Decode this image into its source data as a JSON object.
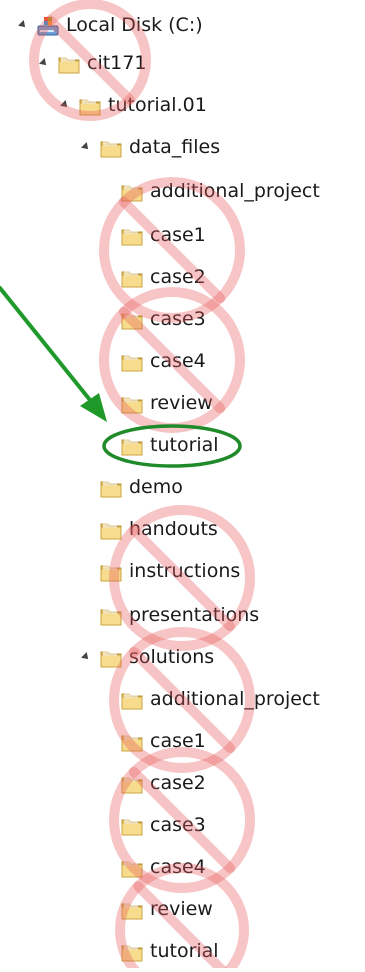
{
  "tree": {
    "items": [
      {
        "label": "Local Disk (C:)",
        "level": 0,
        "expanded": true,
        "icon": "drive-icon"
      },
      {
        "label": "cit171",
        "level": 1,
        "expanded": true,
        "icon": "folder-icon"
      },
      {
        "label": "tutorial.01",
        "level": 2,
        "expanded": true,
        "icon": "folder-icon"
      },
      {
        "label": "data_files",
        "level": 3,
        "expanded": true,
        "icon": "folder-icon"
      },
      {
        "label": "additional_project",
        "level": 4,
        "icon": "folder-icon"
      },
      {
        "label": "case1",
        "level": 4,
        "icon": "folder-icon"
      },
      {
        "label": "case2",
        "level": 4,
        "icon": "folder-icon"
      },
      {
        "label": "case3",
        "level": 4,
        "icon": "folder-icon"
      },
      {
        "label": "case4",
        "level": 4,
        "icon": "folder-icon"
      },
      {
        "label": "review",
        "level": 4,
        "icon": "folder-icon"
      },
      {
        "label": "tutorial",
        "level": 4,
        "icon": "folder-icon",
        "highlighted": true
      },
      {
        "label": "demo",
        "level": 3,
        "icon": "folder-icon"
      },
      {
        "label": "handouts",
        "level": 3,
        "icon": "folder-icon"
      },
      {
        "label": "instructions",
        "level": 3,
        "icon": "folder-icon"
      },
      {
        "label": "presentations",
        "level": 3,
        "icon": "folder-icon"
      },
      {
        "label": "solutions",
        "level": 3,
        "expanded": true,
        "icon": "folder-icon"
      },
      {
        "label": "additional_project",
        "level": 4,
        "icon": "folder-icon"
      },
      {
        "label": "case1",
        "level": 4,
        "icon": "folder-icon"
      },
      {
        "label": "case2",
        "level": 4,
        "icon": "folder-icon"
      },
      {
        "label": "case3",
        "level": 4,
        "icon": "folder-icon"
      },
      {
        "label": "case4",
        "level": 4,
        "icon": "folder-icon"
      },
      {
        "label": "review",
        "level": 4,
        "icon": "folder-icon"
      },
      {
        "label": "tutorial",
        "level": 4,
        "icon": "folder-icon"
      }
    ]
  },
  "annotations": {
    "highlight_color": "#1f8a2a",
    "arrow_color": "#1f9a2a",
    "prohibit_color": "#e85a5a"
  }
}
